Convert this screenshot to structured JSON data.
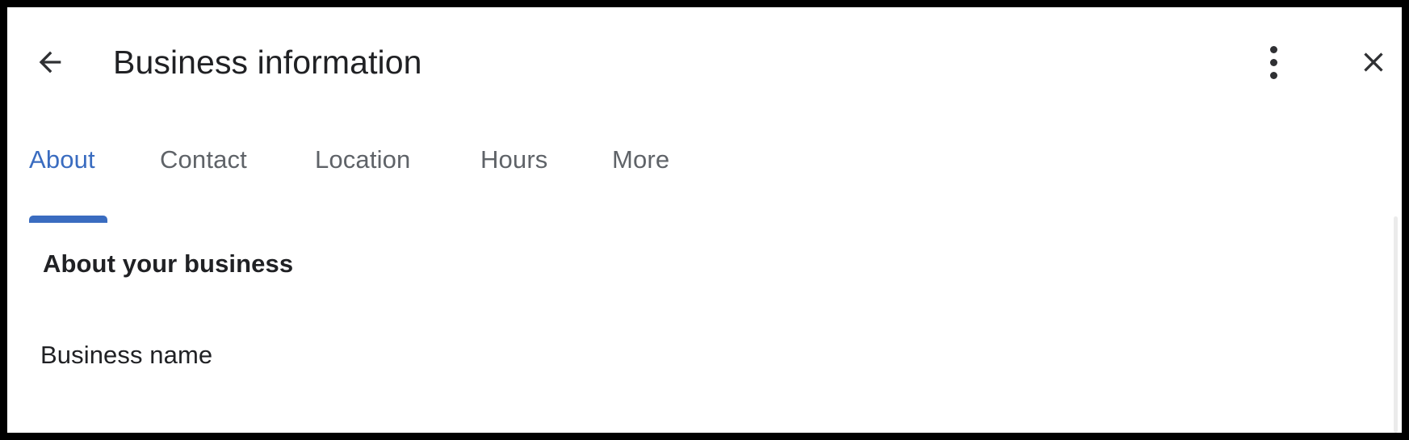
{
  "window": {
    "title": "Business information"
  },
  "header": {
    "back_icon": "arrow-left-icon",
    "overflow_icon": "more-vert-icon",
    "close_icon": "close-icon"
  },
  "tabs": {
    "active_index": 0,
    "items": [
      {
        "label": "About"
      },
      {
        "label": "Contact"
      },
      {
        "label": "Location"
      },
      {
        "label": "Hours"
      },
      {
        "label": "More"
      }
    ]
  },
  "main": {
    "section_heading": "About your business",
    "fields": [
      {
        "label": "Business name"
      }
    ]
  },
  "colors": {
    "accent": "#3a6cc0",
    "text_primary": "#202124",
    "text_secondary": "#5f6368",
    "surface": "#ffffff",
    "frame": "#000000",
    "scrollbar": "#ebebeb"
  }
}
